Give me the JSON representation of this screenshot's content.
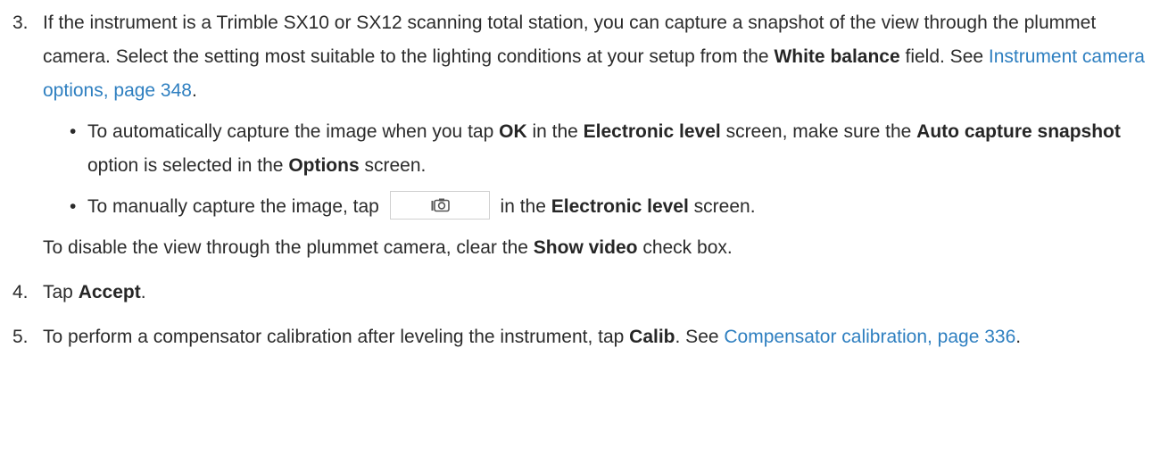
{
  "step3": {
    "number": "3.",
    "t1": "If the instrument is a Trimble SX10 or SX12 scanning total station, you can capture a snapshot of the view through the plummet camera. Select the setting most suitable to the lighting conditions at your setup from the ",
    "b1": "White balance",
    "t2": " field. See ",
    "link": "Instrument camera options, page 348",
    "t3": ".",
    "bullets": [
      {
        "dot": "•",
        "t1": "To automatically capture the image when you tap ",
        "b1": "OK",
        "t2": " in the ",
        "b2": "Electronic level",
        "t3": " screen, make sure the ",
        "b3": "Auto capture snapshot",
        "t4": " option is selected in the ",
        "b4": "Options",
        "t5": " screen."
      },
      {
        "dot": "•",
        "t1": "To manually capture the image, tap ",
        "icon": "camera-capture-icon",
        "t2": " in the ",
        "b1": "Electronic level",
        "t3": " screen."
      }
    ],
    "note": {
      "t1": "To disable the view through the plummet camera, clear the ",
      "b1": "Show video",
      "t2": " check box."
    }
  },
  "step4": {
    "number": "4.",
    "t1": "Tap ",
    "b1": "Accept",
    "t2": "."
  },
  "step5": {
    "number": "5.",
    "t1": "To perform a compensator calibration after leveling the instrument, tap ",
    "b1": "Calib",
    "t2": ". See ",
    "link": "Compensator calibration, page 336",
    "t3": "."
  },
  "colors": {
    "link": "#2e7fc0",
    "text": "#2b2b2b"
  }
}
